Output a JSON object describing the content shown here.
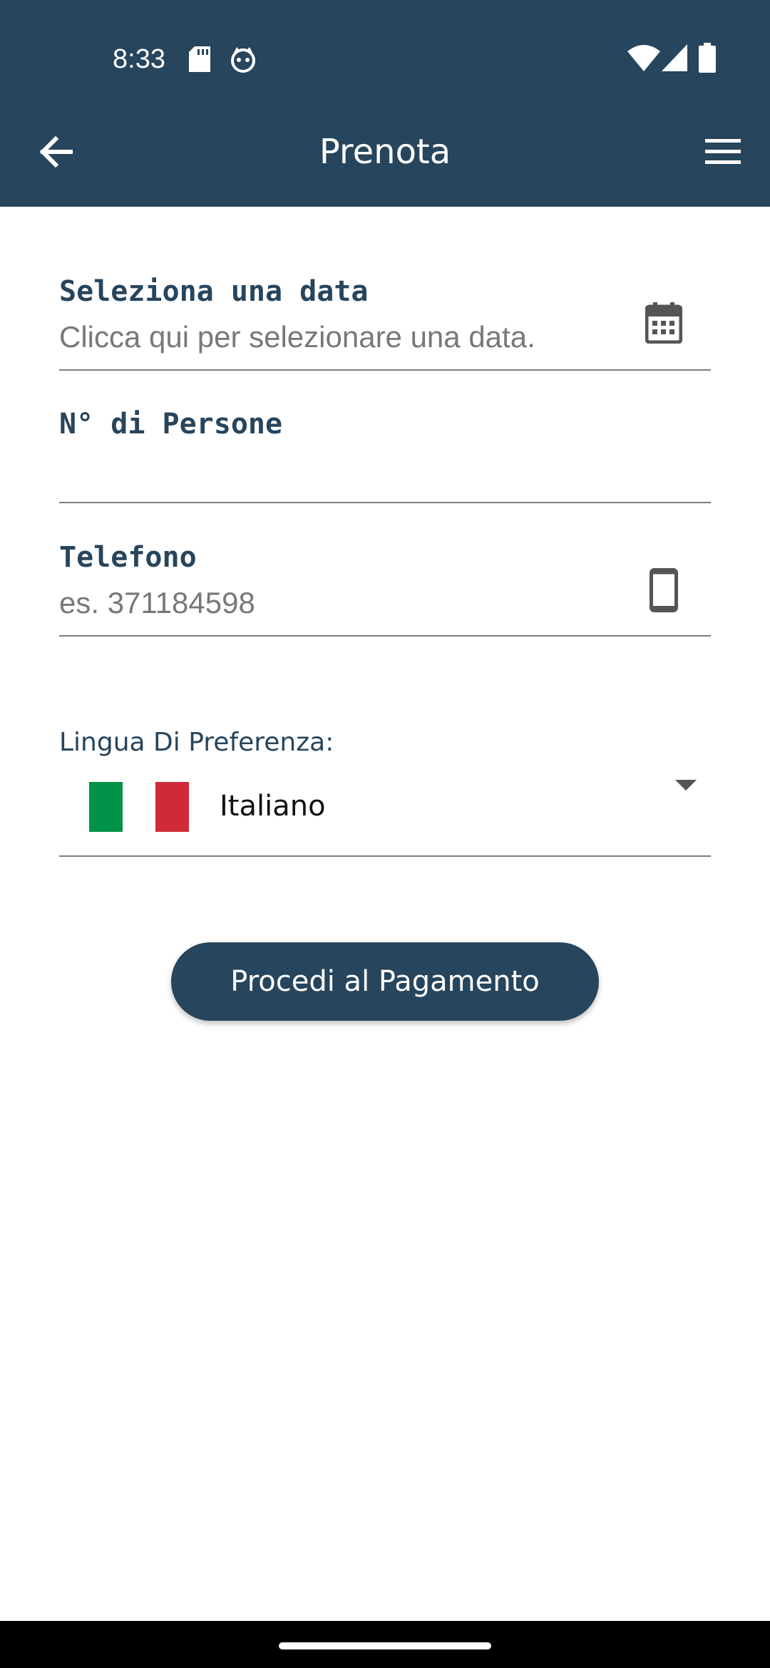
{
  "status_bar": {
    "time": "8:33",
    "left_icons": [
      "sd-card-icon",
      "cat-face-icon"
    ],
    "right_icons": [
      "wifi-icon",
      "cell-signal-icon",
      "battery-icon"
    ]
  },
  "app_bar": {
    "title": "Prenota",
    "back_icon": "arrow-back-icon",
    "menu_icon": "hamburger-menu-icon"
  },
  "form": {
    "date": {
      "label": "Seleziona una data",
      "placeholder": "Clicca qui per selezionare una data.",
      "icon": "calendar-icon"
    },
    "people": {
      "label": "N° di Persone",
      "value": ""
    },
    "phone": {
      "label": "Telefono",
      "placeholder": "es. 371184598",
      "icon": "smartphone-icon"
    },
    "language": {
      "label": "Lingua Di Preferenza:",
      "selected": "Italiano",
      "flag_icon": "italy-flag-icon",
      "flag_colors": [
        "#009246",
        "#ffffff",
        "#ce2b37"
      ]
    }
  },
  "actions": {
    "pay_label": "Procedi al Pagamento"
  },
  "colors": {
    "primary": "#27455c",
    "background": "#ffffff",
    "underline": "#7d7d7d",
    "placeholder": "#787878"
  }
}
